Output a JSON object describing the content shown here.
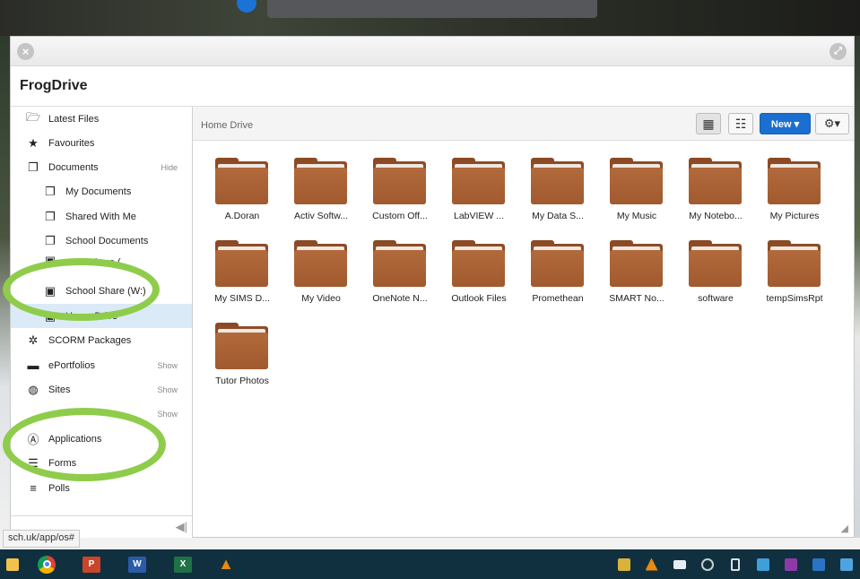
{
  "window": {
    "app_title": "FrogDrive",
    "close_glyph": "×",
    "expand_glyph": "⤢"
  },
  "sidebar": {
    "items": [
      {
        "label": "Latest Files",
        "icon": "latest-files-icon",
        "glyph": "🗁"
      },
      {
        "label": "Favourites",
        "icon": "star-icon",
        "glyph": "★"
      },
      {
        "label": "Documents",
        "icon": "documents-icon",
        "glyph": "❐",
        "toggle": "Hide"
      },
      {
        "label": "My Documents",
        "icon": "my-documents-icon",
        "glyph": "❐"
      },
      {
        "label": "Shared With Me",
        "icon": "shared-icon",
        "glyph": "❐"
      },
      {
        "label": "School Documents",
        "icon": "school-documents-icon",
        "glyph": "❐"
      },
      {
        "label": "Staff Share (",
        "icon": "network-drive-icon",
        "glyph": "▣"
      },
      {
        "label": "School Share (W:)",
        "icon": "network-drive-icon",
        "glyph": "▣"
      },
      {
        "label": "Home Drive",
        "icon": "network-drive-icon",
        "glyph": "▣"
      },
      {
        "label": "SCORM Packages",
        "icon": "scorm-icon",
        "glyph": "✲"
      },
      {
        "label": "ePortfolios",
        "icon": "briefcase-icon",
        "glyph": "▬",
        "toggle": "Show"
      },
      {
        "label": "Sites",
        "icon": "globe-icon",
        "glyph": "◍",
        "toggle": "Show"
      },
      {
        "label": "",
        "icon": "hidden-item-icon",
        "glyph": "",
        "toggle": "Show"
      },
      {
        "label": "Applications",
        "icon": "applications-icon",
        "glyph": "Ⓐ"
      },
      {
        "label": "Forms",
        "icon": "forms-icon",
        "glyph": "☰"
      },
      {
        "label": "Polls",
        "icon": "polls-icon",
        "glyph": "≡"
      }
    ],
    "collapse_glyph": "◀|"
  },
  "toolbar": {
    "breadcrumb": "Home Drive",
    "grid_view_glyph": "▦",
    "list_view_glyph": "☷",
    "new_label": "New ▾",
    "settings_glyph": "⚙▾"
  },
  "folders": [
    "A.Doran",
    "Activ Softw...",
    "Custom Off...",
    "LabVIEW ...",
    "My Data S...",
    "My Music",
    "My Notebo...",
    "My Pictures",
    "My SIMS D...",
    "My Video",
    "OneNote N...",
    "Outlook Files",
    "Promethean",
    "SMART No...",
    "software",
    "tempSimsRpt",
    "Tutor Photos"
  ],
  "status": {
    "url": "sch.uk/app/os#"
  },
  "taskbar": {
    "apps": [
      {
        "icon": "file-explorer-icon",
        "glyph": "",
        "color": "#f3c24a"
      },
      {
        "icon": "chrome-icon",
        "glyph": "",
        "color": "#2f8ae5"
      },
      {
        "icon": "powerpoint-icon",
        "glyph": "P",
        "color": "#c9462a"
      },
      {
        "icon": "word-icon",
        "glyph": "W",
        "color": "#2a5ba8"
      },
      {
        "icon": "excel-icon",
        "glyph": "X",
        "color": "#1e7245"
      },
      {
        "icon": "vlc-icon",
        "glyph": "▲",
        "color": "#e88a12"
      }
    ],
    "tray": [
      {
        "icon": "shield-icon",
        "color": "#d9b23a"
      },
      {
        "icon": "vlc-tray-icon",
        "color": "#e88a12"
      },
      {
        "icon": "mail-icon",
        "color": "#e6eef5"
      },
      {
        "icon": "circle-tray-icon",
        "color": "#c7cdd2"
      },
      {
        "icon": "usb-icon",
        "color": "#e0e0e0"
      },
      {
        "icon": "people-icon",
        "color": "#3f9fd8"
      },
      {
        "icon": "onenote-tray-icon",
        "color": "#8d3aa8"
      },
      {
        "icon": "outlook-tray-icon",
        "color": "#2b74c5"
      },
      {
        "icon": "network-tray-icon",
        "color": "#4fa3e0"
      }
    ]
  },
  "colors": {
    "accent": "#1a6fd1",
    "active_nav": "#dbeaf7",
    "folder": "#a05a2e",
    "annotation_ring": "#8fcc4b",
    "taskbar": "#11303f"
  }
}
